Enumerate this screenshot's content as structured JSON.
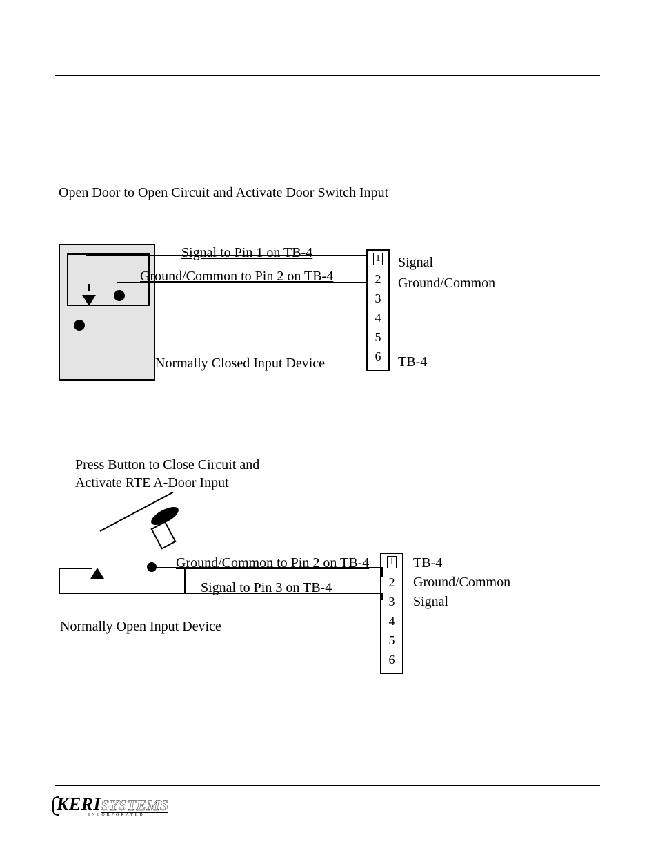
{
  "figures": {
    "fig1": {
      "intro": "Open Door to Open Circuit and Activate Door Switch Input",
      "wire_label_signal": "Signal to Pin 1 on TB-4",
      "wire_label_ground": "Ground/Common to Pin 2 on TB-4",
      "device_label": "Normally Closed Input Device",
      "side_signal": "Signal",
      "side_ground": "Ground/Common",
      "side_tb": "TB-4"
    },
    "fig2": {
      "intro_line1": "Press Button to Close Circuit and",
      "intro_line2": "Activate RTE A-Door Input",
      "wire_label_ground": "Ground/Common to Pin 2 on TB-4",
      "wire_label_signal": "Signal to Pin 3 on TB-4",
      "device_label": "Normally Open Input Device",
      "side_tb": "TB-4",
      "side_ground": "Ground/Common",
      "side_signal": "Signal"
    },
    "pins": [
      "1",
      "2",
      "3",
      "4",
      "5",
      "6"
    ]
  },
  "logo": {
    "brand_left": "KERI",
    "brand_right": "SYSTEMS",
    "sub": "INCORPORATED"
  }
}
